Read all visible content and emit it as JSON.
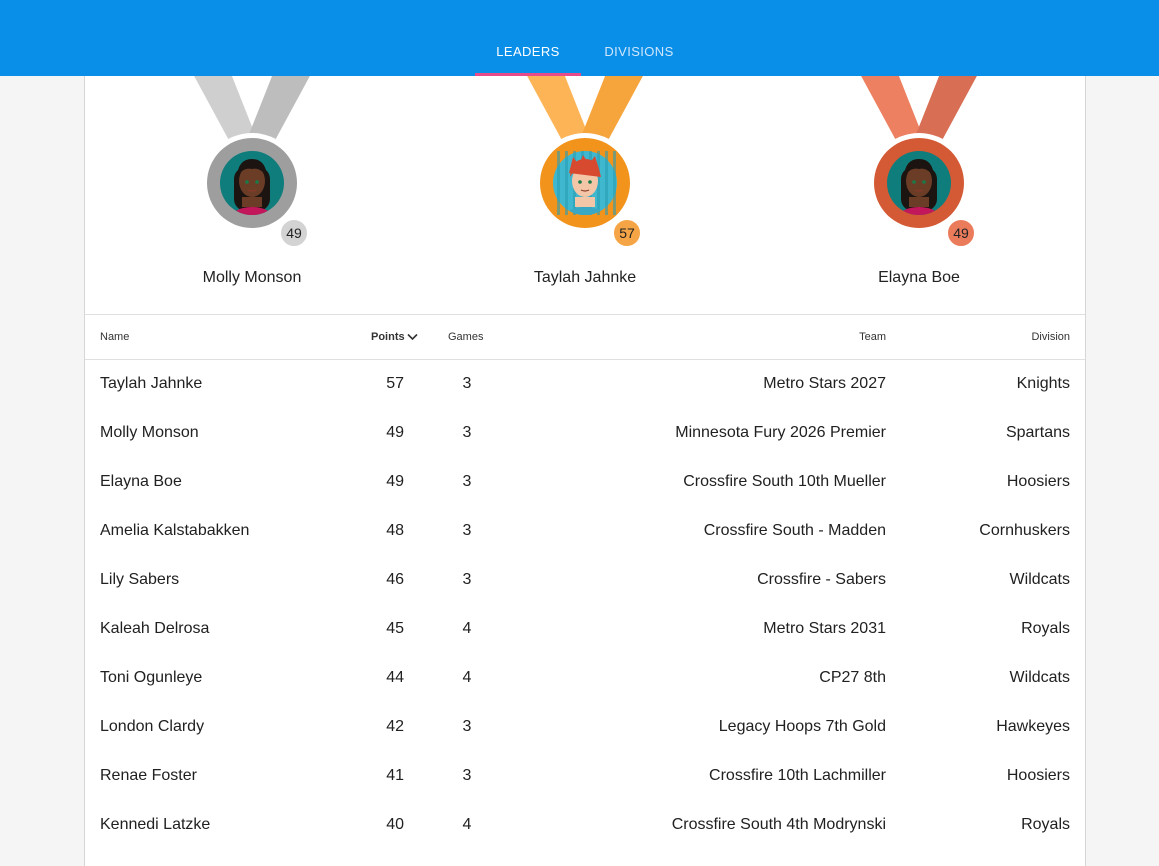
{
  "tabs": [
    {
      "label": "LEADERS",
      "active": true
    },
    {
      "label": "DIVISIONS",
      "active": false
    }
  ],
  "podium": [
    {
      "rank": 2,
      "name": "Molly Monson",
      "points": "49",
      "medal": "silver",
      "avatar_icon": "player-avatar-icon",
      "colors": {
        "ribbon_left": "#cfcfcf",
        "ribbon_right": "#bdbdbd",
        "ring": "#9e9e9e",
        "badge": "#d3d3d3"
      }
    },
    {
      "rank": 1,
      "name": "Taylah Jahnke",
      "points": "57",
      "medal": "gold",
      "avatar_icon": "player-avatar-icon",
      "colors": {
        "ribbon_left": "#fdb456",
        "ribbon_right": "#f6a43c",
        "ring": "#f2931c",
        "badge": "#f5a545"
      }
    },
    {
      "rank": 3,
      "name": "Elayna Boe",
      "points": "49",
      "medal": "bronze",
      "avatar_icon": "player-avatar-icon",
      "colors": {
        "ribbon_left": "#ec8060",
        "ribbon_right": "#d86e54",
        "ring": "#d45a35",
        "badge": "#ea7c5c"
      }
    }
  ],
  "table": {
    "headers": {
      "name": "Name",
      "points": "Points",
      "games": "Games",
      "team": "Team",
      "division": "Division"
    },
    "sort_column": "points",
    "sort_direction": "descending",
    "rows": [
      {
        "name": "Taylah Jahnke",
        "points": "57",
        "games": "3",
        "team": "Metro Stars 2027",
        "division": "Knights"
      },
      {
        "name": "Molly Monson",
        "points": "49",
        "games": "3",
        "team": "Minnesota Fury 2026 Premier",
        "division": "Spartans"
      },
      {
        "name": "Elayna Boe",
        "points": "49",
        "games": "3",
        "team": "Crossfire South 10th Mueller",
        "division": "Hoosiers"
      },
      {
        "name": "Amelia Kalstabakken",
        "points": "48",
        "games": "3",
        "team": "Crossfire South - Madden",
        "division": "Cornhuskers"
      },
      {
        "name": "Lily Sabers",
        "points": "46",
        "games": "3",
        "team": "Crossfire - Sabers",
        "division": "Wildcats"
      },
      {
        "name": "Kaleah Delrosa",
        "points": "45",
        "games": "4",
        "team": "Metro Stars 2031",
        "division": "Royals"
      },
      {
        "name": "Toni Ogunleye",
        "points": "44",
        "games": "4",
        "team": "CP27 8th",
        "division": "Wildcats"
      },
      {
        "name": "London Clardy",
        "points": "42",
        "games": "3",
        "team": "Legacy Hoops 7th Gold",
        "division": "Hawkeyes"
      },
      {
        "name": "Renae Foster",
        "points": "41",
        "games": "3",
        "team": "Crossfire 10th Lachmiller",
        "division": "Hoosiers"
      },
      {
        "name": "Kennedi Latzke",
        "points": "40",
        "games": "4",
        "team": "Crossfire South 4th Modrynski",
        "division": "Royals"
      }
    ]
  },
  "theme": {
    "app_bar": "#0a8fe8",
    "tab_indicator": "#e84b8a"
  }
}
